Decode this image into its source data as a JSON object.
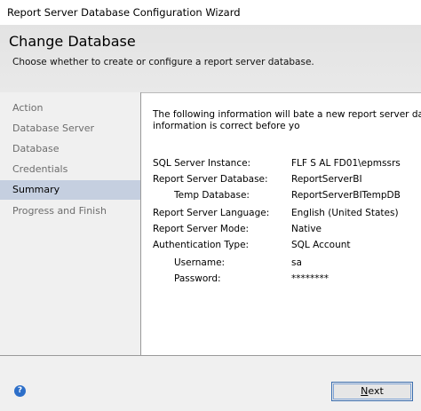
{
  "window": {
    "title": "Report Server Database Configuration Wizard"
  },
  "header": {
    "title": "Change Database",
    "subtitle": "Choose whether to create or configure a report server database."
  },
  "nav": {
    "items": [
      {
        "label": "Action",
        "active": false
      },
      {
        "label": "Database Server",
        "active": false
      },
      {
        "label": "Database",
        "active": false
      },
      {
        "label": "Credentials",
        "active": false
      },
      {
        "label": "Summary",
        "active": true
      },
      {
        "label": "Progress and Finish",
        "active": false
      }
    ]
  },
  "summary": {
    "intro_line1": "The following information will bate a new report server database. V",
    "intro_line2": "information is correct before yo",
    "rows": [
      {
        "label": "SQL Server Instance:",
        "value": "FLF S AL FD01\\epmssrs"
      },
      {
        "label": "Report Server Database:",
        "value": "ReportServerBI"
      },
      {
        "label": "Temp Database:",
        "value": "ReportServerBITempDB"
      },
      {
        "label": "Report Server Language:",
        "value": "English (United States)"
      },
      {
        "label": "Report Server Mode:",
        "value": "Native"
      },
      {
        "label": "Authentication Type:",
        "value": "SQL Account"
      },
      {
        "label": "Username:",
        "value": "sa"
      },
      {
        "label": "Password:",
        "value": "********"
      }
    ]
  },
  "footer": {
    "help_label": "?",
    "next_label_u": "N",
    "next_label_rest": "ext"
  }
}
